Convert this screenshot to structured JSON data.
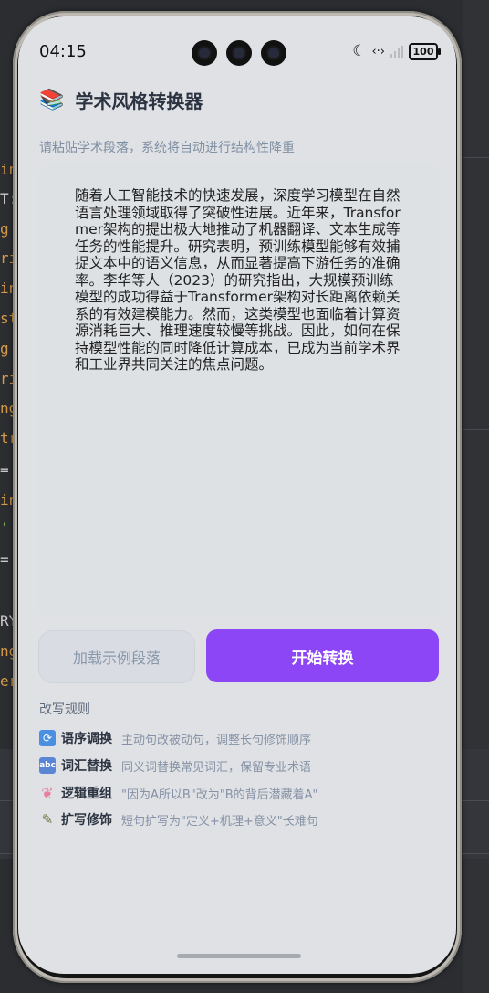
{
  "app": {
    "title": "学术风格转换器",
    "icon": "books-icon"
  },
  "status_bar": {
    "time": "04:15",
    "battery": "100"
  },
  "input": {
    "hint": "请粘贴学术段落，系统将自动进行结构性降重",
    "value": "随着人工智能技术的快速发展，深度学习模型在自然语言处理领域取得了突破性进展。近年来，Transformer架构的提出极大地推动了机器翻译、文本生成等任务的性能提升。研究表明，预训练模型能够有效捕捉文本中的语义信息，从而显著提高下游任务的准确率。李华等人（2023）的研究指出，大规模预训练模型的成功得益于Transformer架构对长距离依赖关系的有效建模能力。然而，这类模型也面临着计算资源消耗巨大、推理速度较慢等挑战。因此，如何在保持模型性能的同时降低计算成本，已成为当前学术界和工业界共同关注的焦点问题。"
  },
  "buttons": {
    "load_example": "加载示例段落",
    "start": "开始转换"
  },
  "rules": {
    "title": "改写规则",
    "items": [
      {
        "icon": "cycle-icon",
        "name": "语序调换",
        "desc": "主动句改被动句，调整长句修饰顺序"
      },
      {
        "icon": "abc-icon",
        "name": "词汇替换",
        "desc": "同义词替换常见词汇，保留专业术语"
      },
      {
        "icon": "brain-icon",
        "name": "逻辑重组",
        "desc": "\"因为A所以B\"改为\"B的背后潜藏着A\""
      },
      {
        "icon": "pen-icon",
        "name": "扩写修饰",
        "desc": "短句扩写为\"定义+机理+意义\"长难句"
      }
    ]
  },
  "colors": {
    "accent": "#8d46f6",
    "background": "#dfe1e4"
  }
}
